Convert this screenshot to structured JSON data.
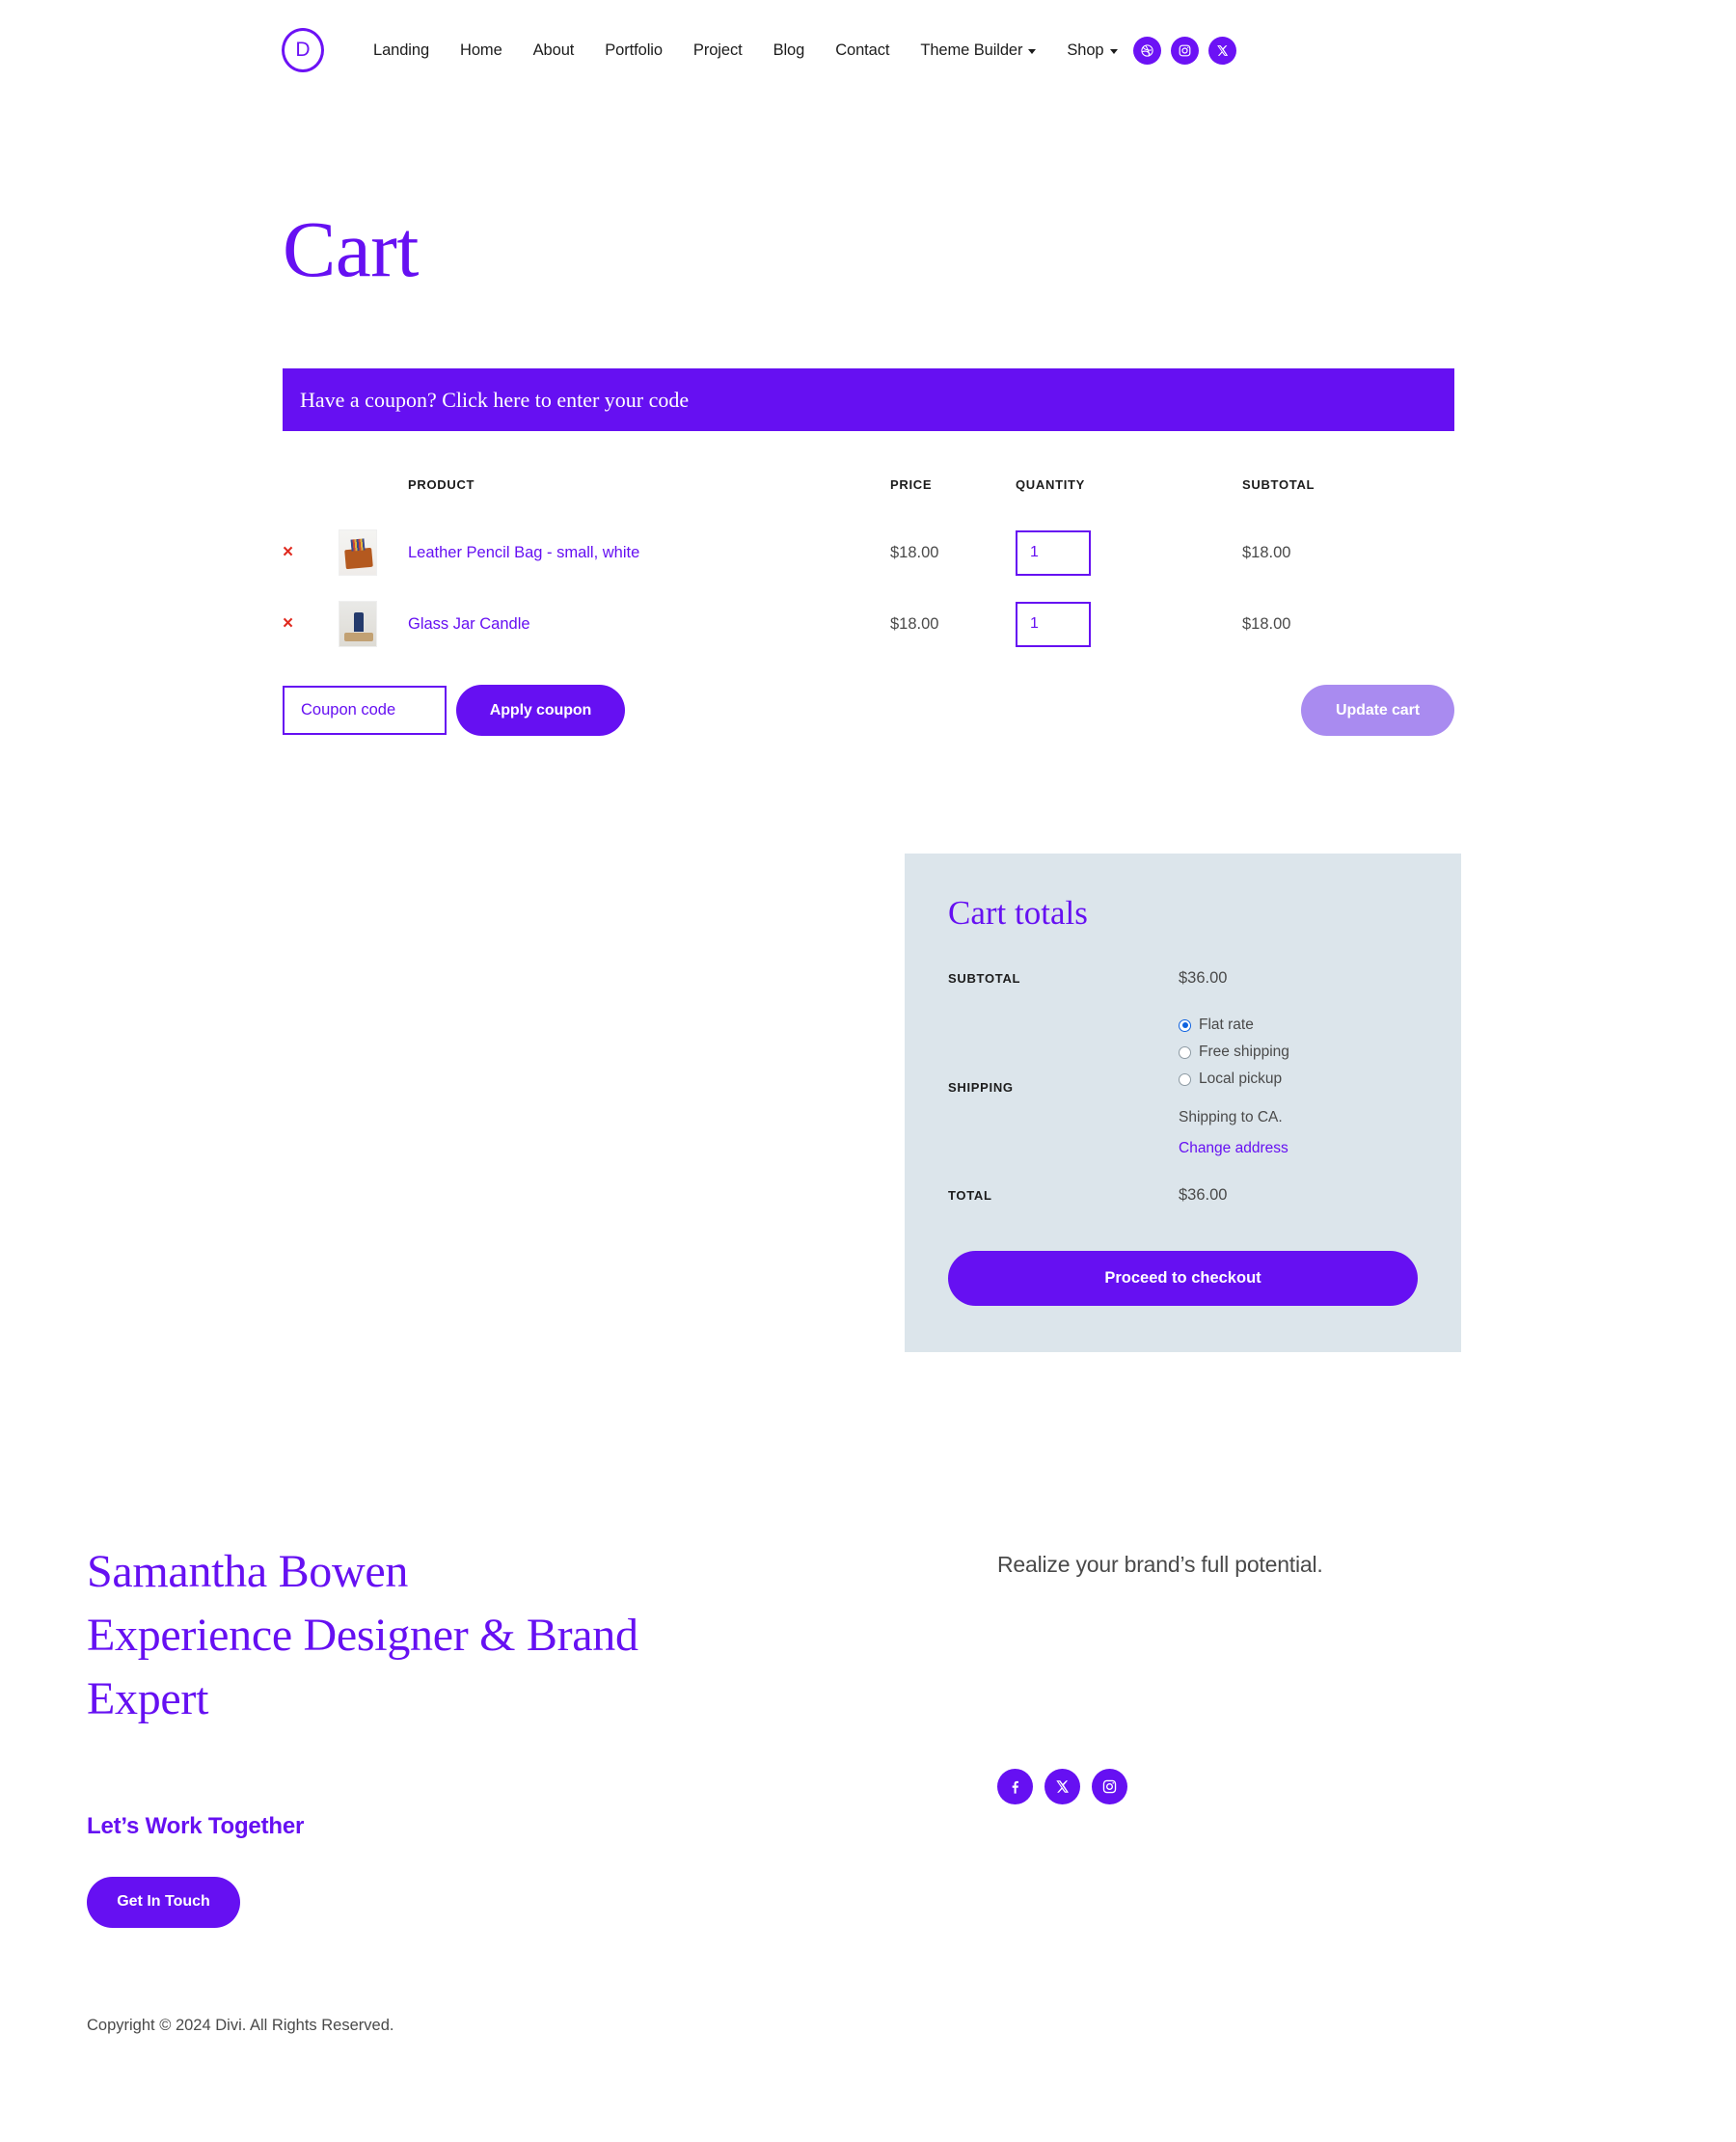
{
  "header": {
    "logo_letter": "D",
    "nav": [
      {
        "label": "Landing",
        "has_caret": false
      },
      {
        "label": "Home",
        "has_caret": false
      },
      {
        "label": "About",
        "has_caret": false
      },
      {
        "label": "Portfolio",
        "has_caret": false
      },
      {
        "label": "Project",
        "has_caret": false
      },
      {
        "label": "Blog",
        "has_caret": false
      },
      {
        "label": "Contact",
        "has_caret": false
      },
      {
        "label": "Theme Builder",
        "has_caret": true
      },
      {
        "label": "Shop",
        "has_caret": true
      }
    ],
    "socials": [
      "dribbble-icon",
      "instagram-icon",
      "x-icon"
    ]
  },
  "page": {
    "title": "Cart",
    "coupon_banner": "Have a coupon? Click here to enter your code"
  },
  "cart": {
    "columns": {
      "product": "PRODUCT",
      "price": "PRICE",
      "quantity": "QUANTITY",
      "subtotal": "SUBTOTAL"
    },
    "remove_glyph": "×",
    "items": [
      {
        "name": "Leather Pencil Bag - small, white",
        "price": "$18.00",
        "quantity": "1",
        "subtotal": "$18.00",
        "thumb": "leather-pencil-bag-thumbnail"
      },
      {
        "name": "Glass Jar Candle",
        "price": "$18.00",
        "quantity": "1",
        "subtotal": "$18.00",
        "thumb": "glass-jar-candle-thumbnail"
      }
    ],
    "coupon_placeholder": "Coupon code",
    "apply_coupon_label": "Apply coupon",
    "update_cart_label": "Update cart"
  },
  "totals": {
    "title": "Cart totals",
    "subtotal_label": "SUBTOTAL",
    "subtotal_value": "$36.00",
    "shipping_label": "SHIPPING",
    "shipping_options": [
      {
        "label": "Flat rate",
        "selected": true
      },
      {
        "label": "Free shipping",
        "selected": false
      },
      {
        "label": "Local pickup",
        "selected": false
      }
    ],
    "shipping_to": "Shipping to CA.",
    "change_address": "Change address",
    "total_label": "TOTAL",
    "total_value": "$36.00",
    "checkout_label": "Proceed to checkout"
  },
  "footer": {
    "heading_line1": "Samantha Bowen",
    "heading_line2": "Experience Designer & Brand",
    "heading_line3": "Expert",
    "tagline": "Realize your brand’s full potential.",
    "lets_work": "Let’s Work Together",
    "get_in_touch": "Get In Touch",
    "socials": [
      "facebook-icon",
      "x-icon",
      "instagram-icon"
    ],
    "copyright": "Copyright © 2024 Divi. All Rights Reserved."
  },
  "colors": {
    "brand_purple": "#6610f2",
    "header_purple": "#6c12f5",
    "panel_bg": "#dce5eb",
    "remove_red": "#e02b20",
    "radio_blue": "#1063e0",
    "disabled_purple": "#a98bf0"
  }
}
